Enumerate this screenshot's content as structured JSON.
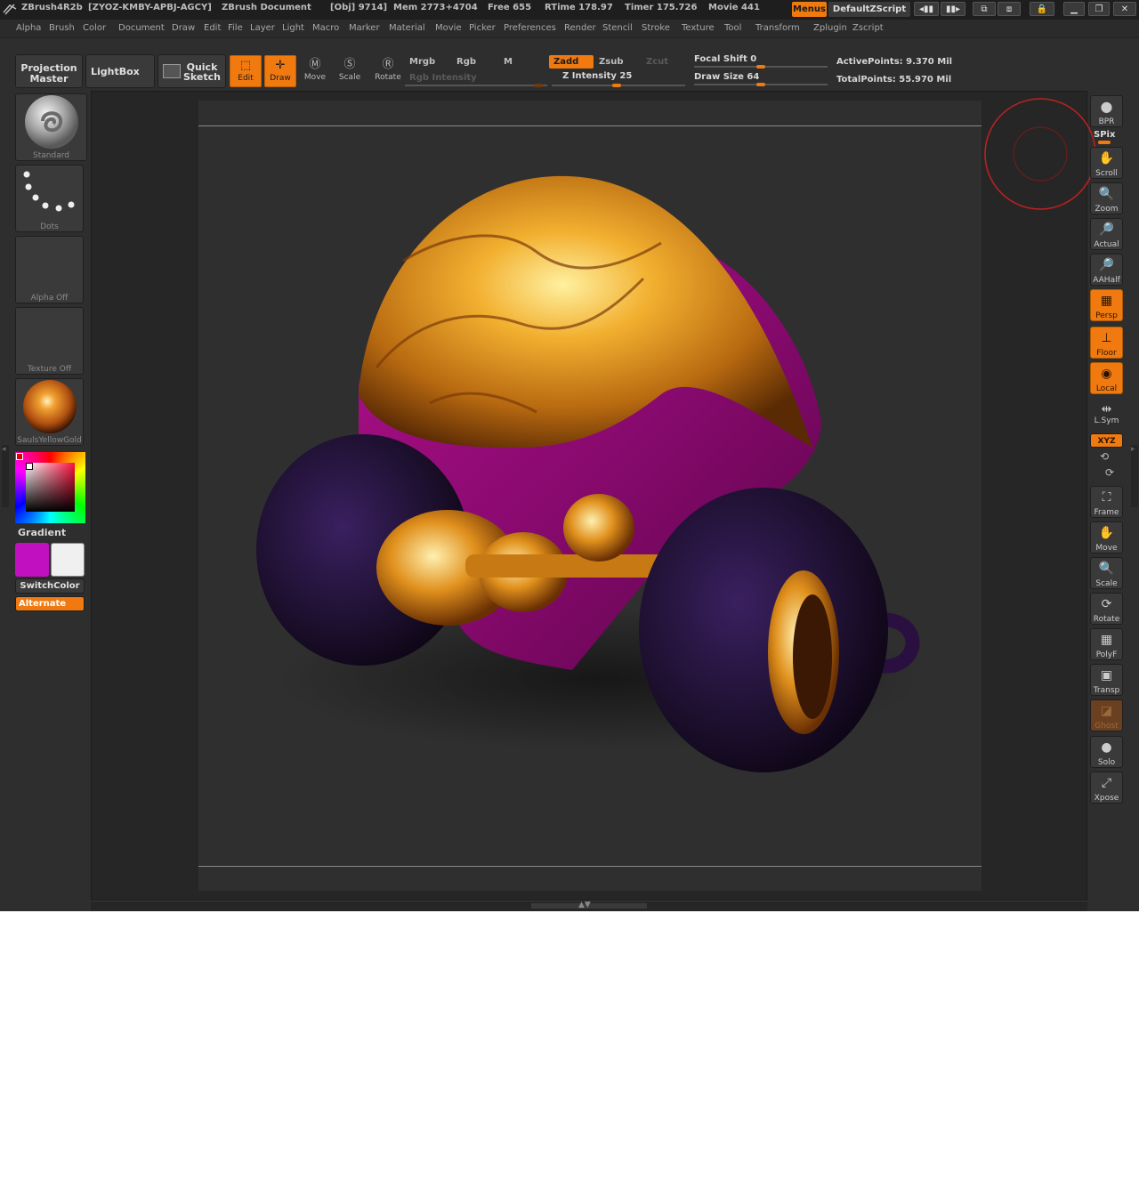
{
  "titlebar": {
    "app": "ZBrush4R2b",
    "serial": "[ZYOZ-KMBY-APBJ-AGCY]",
    "document": "ZBrush Document",
    "obj": "[Obj] 9714]",
    "mem": "Mem 2773+4704",
    "free": "Free 655",
    "rtime": "RTime 178.97",
    "timer": "Timer 175.726",
    "movie": "Movie 441",
    "menus_label": "Menus",
    "script_label": "DefaultZScript"
  },
  "menubar": {
    "items": [
      "Alpha",
      "Brush",
      "Color",
      "Document",
      "Draw",
      "Edit",
      "File",
      "Layer",
      "Light",
      "Macro",
      "Marker",
      "Material",
      "Movie",
      "Picker",
      "Preferences",
      "Render",
      "Stencil",
      "Stroke",
      "Texture",
      "Tool",
      "Transform",
      "Zplugin",
      "Zscript"
    ]
  },
  "toolbar": {
    "projection_master": [
      "Projection",
      "Master"
    ],
    "lightbox": "LightBox",
    "quick_sketch": [
      "Quick",
      "Sketch"
    ],
    "edit": "Edit",
    "draw": "Draw",
    "move": "Move",
    "scale": "Scale",
    "rotate": "Rotate",
    "mrgb": "Mrgb",
    "rgb": "Rgb",
    "m": "M",
    "zadd": "Zadd",
    "zsub": "Zsub",
    "zcut": "Zcut",
    "rgb_intensity": "Rgb Intensity",
    "z_intensity": "Z Intensity 25",
    "focal_shift": "Focal Shift 0",
    "draw_size": "Draw Size 64",
    "active_points": "ActivePoints: 9.370 Mil",
    "total_points": "TotalPoints: 55.970 Mil"
  },
  "sliders": {
    "focal_shift": 0,
    "draw_size": 64,
    "z_intensity": 25
  },
  "leftpanel": {
    "brush": "Standard",
    "stroke": "Dots",
    "alpha": "Alpha Off",
    "texture": "Texture Off",
    "material": "SaulsYellowGold",
    "gradient": "Gradient",
    "switch_color": "SwitchColor",
    "alternate": "Alternate"
  },
  "rightpanel": {
    "bpr": "BPR",
    "spix": "SPix",
    "buttons": [
      "Scroll",
      "Zoom",
      "Actual",
      "AAHalf",
      "Persp",
      "Floor",
      "Local",
      "L.Sym",
      "XYZ",
      "Frame",
      "Move",
      "Scale",
      "Rotate",
      "PolyF",
      "Transp",
      "Ghost",
      "Solo",
      "Xpose"
    ]
  },
  "colors": {
    "accent": "#f07a10",
    "primary_color": "#c010c0",
    "secondary_color": "#f0f0f0",
    "background": "#2e2e2e"
  }
}
